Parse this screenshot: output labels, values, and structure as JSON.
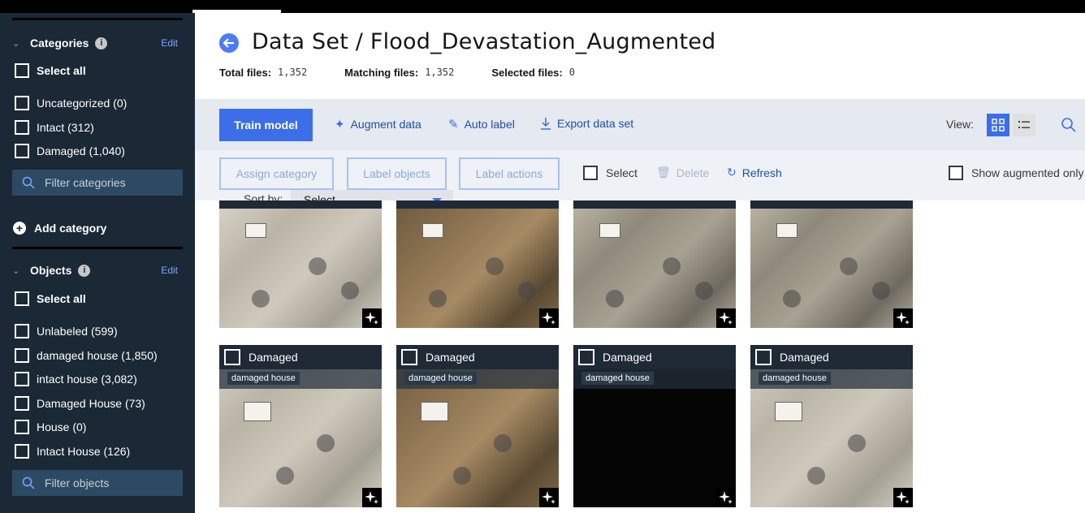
{
  "sidebar": {
    "categories": {
      "title": "Categories",
      "edit_label": "Edit",
      "select_all": "Select all",
      "items": [
        {
          "label": "Uncategorized (0)"
        },
        {
          "label": "Intact (312)"
        },
        {
          "label": "Damaged (1,040)"
        }
      ],
      "filter_placeholder": "Filter categories",
      "add_label": "Add category"
    },
    "objects": {
      "title": "Objects",
      "edit_label": "Edit",
      "select_all": "Select all",
      "items": [
        {
          "label": "Unlabeled (599)"
        },
        {
          "label": "damaged house (1,850)"
        },
        {
          "label": "intact house (3,082)"
        },
        {
          "label": "Damaged House (73)"
        },
        {
          "label": "House (0)"
        },
        {
          "label": "Intact House (126)"
        }
      ],
      "filter_placeholder": "Filter objects"
    }
  },
  "header": {
    "title": "Data Set / Flood_Devastation_Augmented",
    "stats": [
      {
        "label": "Total files:",
        "value": "1,352"
      },
      {
        "label": "Matching files:",
        "value": "1,352"
      },
      {
        "label": "Selected files:",
        "value": "0"
      }
    ]
  },
  "toolbar": {
    "train_label": "Train model",
    "augment_label": "Augment data",
    "autolabel_label": "Auto label",
    "export_label": "Export data set",
    "view_label": "View:"
  },
  "toolbar2": {
    "assign_label": "Assign category",
    "label_objects": "Label objects",
    "label_actions": "Label actions",
    "select_label": "Select",
    "delete_label": "Delete",
    "refresh_label": "Refresh",
    "show_aug_label": "Show augmented only",
    "sort_label": "Sort by:",
    "sort_value": "Select"
  },
  "grid": {
    "row2": [
      {
        "category": "Damaged",
        "tag": "damaged house"
      },
      {
        "category": "Damaged",
        "tag": "damaged house"
      },
      {
        "category": "Damaged",
        "tag": "damaged house"
      },
      {
        "category": "Damaged",
        "tag": "damaged house"
      }
    ]
  },
  "colors": {
    "sidebar_bg": "#1b2836",
    "accent": "#3b6ee8",
    "toolbar_bg": "#e5e9f0"
  }
}
